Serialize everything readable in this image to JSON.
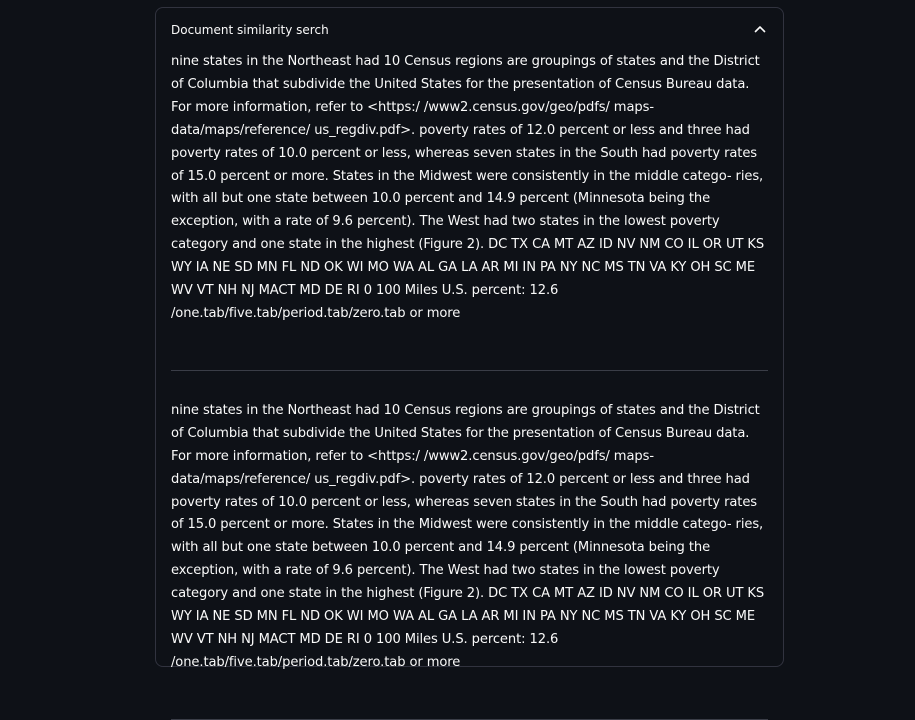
{
  "expander": {
    "title": "Document similarity serch",
    "expanded": true,
    "toggle_icon": "chevron-up-icon"
  },
  "results": [
    {
      "text": "nine states in the Northeast had 10 Census regions are groupings of states and the District of Columbia that subdivide the United States for the presentation of Census Bureau data. For more information, refer to <https:/ /www2.census.gov/geo/pdfs/ maps-data/maps/reference/ us_regdiv.pdf>. poverty rates of 12.0 percent or less and three had poverty rates of 10.0 percent or less, whereas seven states in the South had poverty rates of 15.0 percent or more. States in the Midwest were consistently in the middle catego- ries, with all but one state between 10.0 percent and 14.9 percent (Minnesota being the exception, with a rate of 9.6 percent). The West had two states in the lowest poverty category and one state in the highest (Figure 2). DC TX CA MT AZ ID NV NM CO IL OR UT KS WY IA NE SD MN FL ND OK WI MO WA AL GA LA AR MI IN PA NY NC MS TN VA KY OH SC ME WV VT NH NJ MACT MD DE RI 0 100 Miles U.S. percent: 12.6 /one.tab/five.tab/period.tab/zero.tab or more"
    },
    {
      "text": "nine states in the Northeast had 10 Census regions are groupings of states and the District of Columbia that subdivide the United States for the presentation of Census Bureau data. For more information, refer to <https:/ /www2.census.gov/geo/pdfs/ maps-data/maps/reference/ us_regdiv.pdf>. poverty rates of 12.0 percent or less and three had poverty rates of 10.0 percent or less, whereas seven states in the South had poverty rates of 15.0 percent or more. States in the Midwest were consistently in the middle catego- ries, with all but one state between 10.0 percent and 14.9 percent (Minnesota being the exception, with a rate of 9.6 percent). The West had two states in the lowest poverty category and one state in the highest (Figure 2). DC TX CA MT AZ ID NV NM CO IL OR UT KS WY IA NE SD MN FL ND OK WI MO WA AL GA LA AR MI IN PA NY NC MS TN VA KY OH SC ME WV VT NH NJ MACT MD DE RI 0 100 Miles U.S. percent: 12.6 /one.tab/five.tab/period.tab/zero.tab or more"
    }
  ],
  "colors": {
    "background": "#0e1117",
    "border": "#31333f",
    "text": "#fafafa",
    "divider": "#3a3d47"
  }
}
